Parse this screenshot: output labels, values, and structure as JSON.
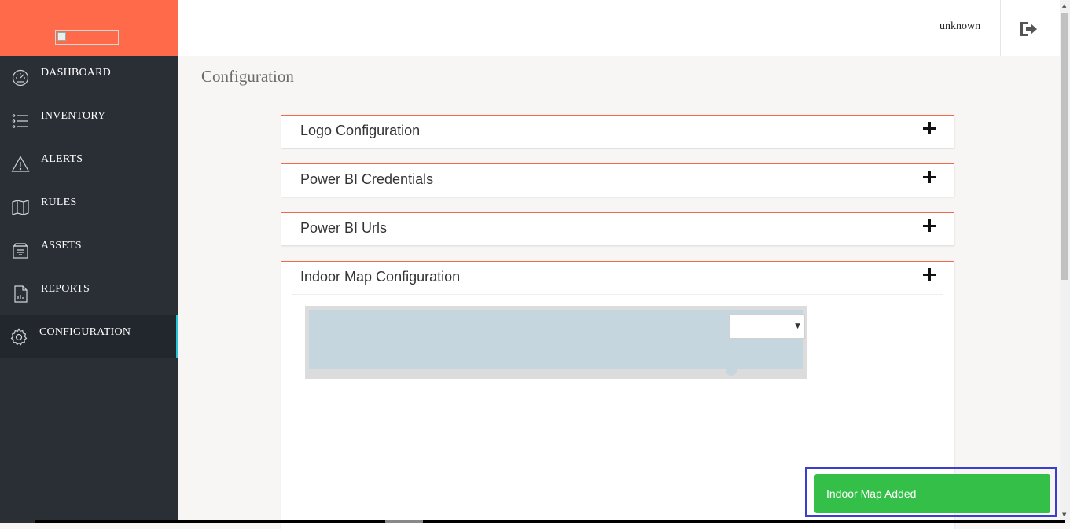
{
  "header": {
    "user": "unknown",
    "logout_icon": "sign-out-icon"
  },
  "colors": {
    "brand": "#ff6b4a",
    "sidebar": "#2a2f36",
    "accent": "#27c3d8",
    "panel_border": "#f06b4d",
    "toast": "#34c048",
    "highlight": "#3a3fcf"
  },
  "sidebar": {
    "items": [
      {
        "label": "DASHBOARD",
        "icon": "speedometer-icon"
      },
      {
        "label": "INVENTORY",
        "icon": "list-icon"
      },
      {
        "label": "ALERTS",
        "icon": "warning-icon"
      },
      {
        "label": "RULES",
        "icon": "map-icon"
      },
      {
        "label": "ASSETS",
        "icon": "archive-icon"
      },
      {
        "label": "REPORTS",
        "icon": "report-icon"
      },
      {
        "label": "CONFIGURATION",
        "icon": "gear-icon",
        "active": true
      }
    ]
  },
  "main": {
    "title": "Configuration",
    "panels": [
      {
        "title": "Logo Configuration"
      },
      {
        "title": "Power BI Credentials"
      },
      {
        "title": "Power BI Urls"
      },
      {
        "title": "Indoor Map Configuration"
      }
    ],
    "map_select_value": ""
  },
  "toast": {
    "message": "Indoor Map Added"
  }
}
